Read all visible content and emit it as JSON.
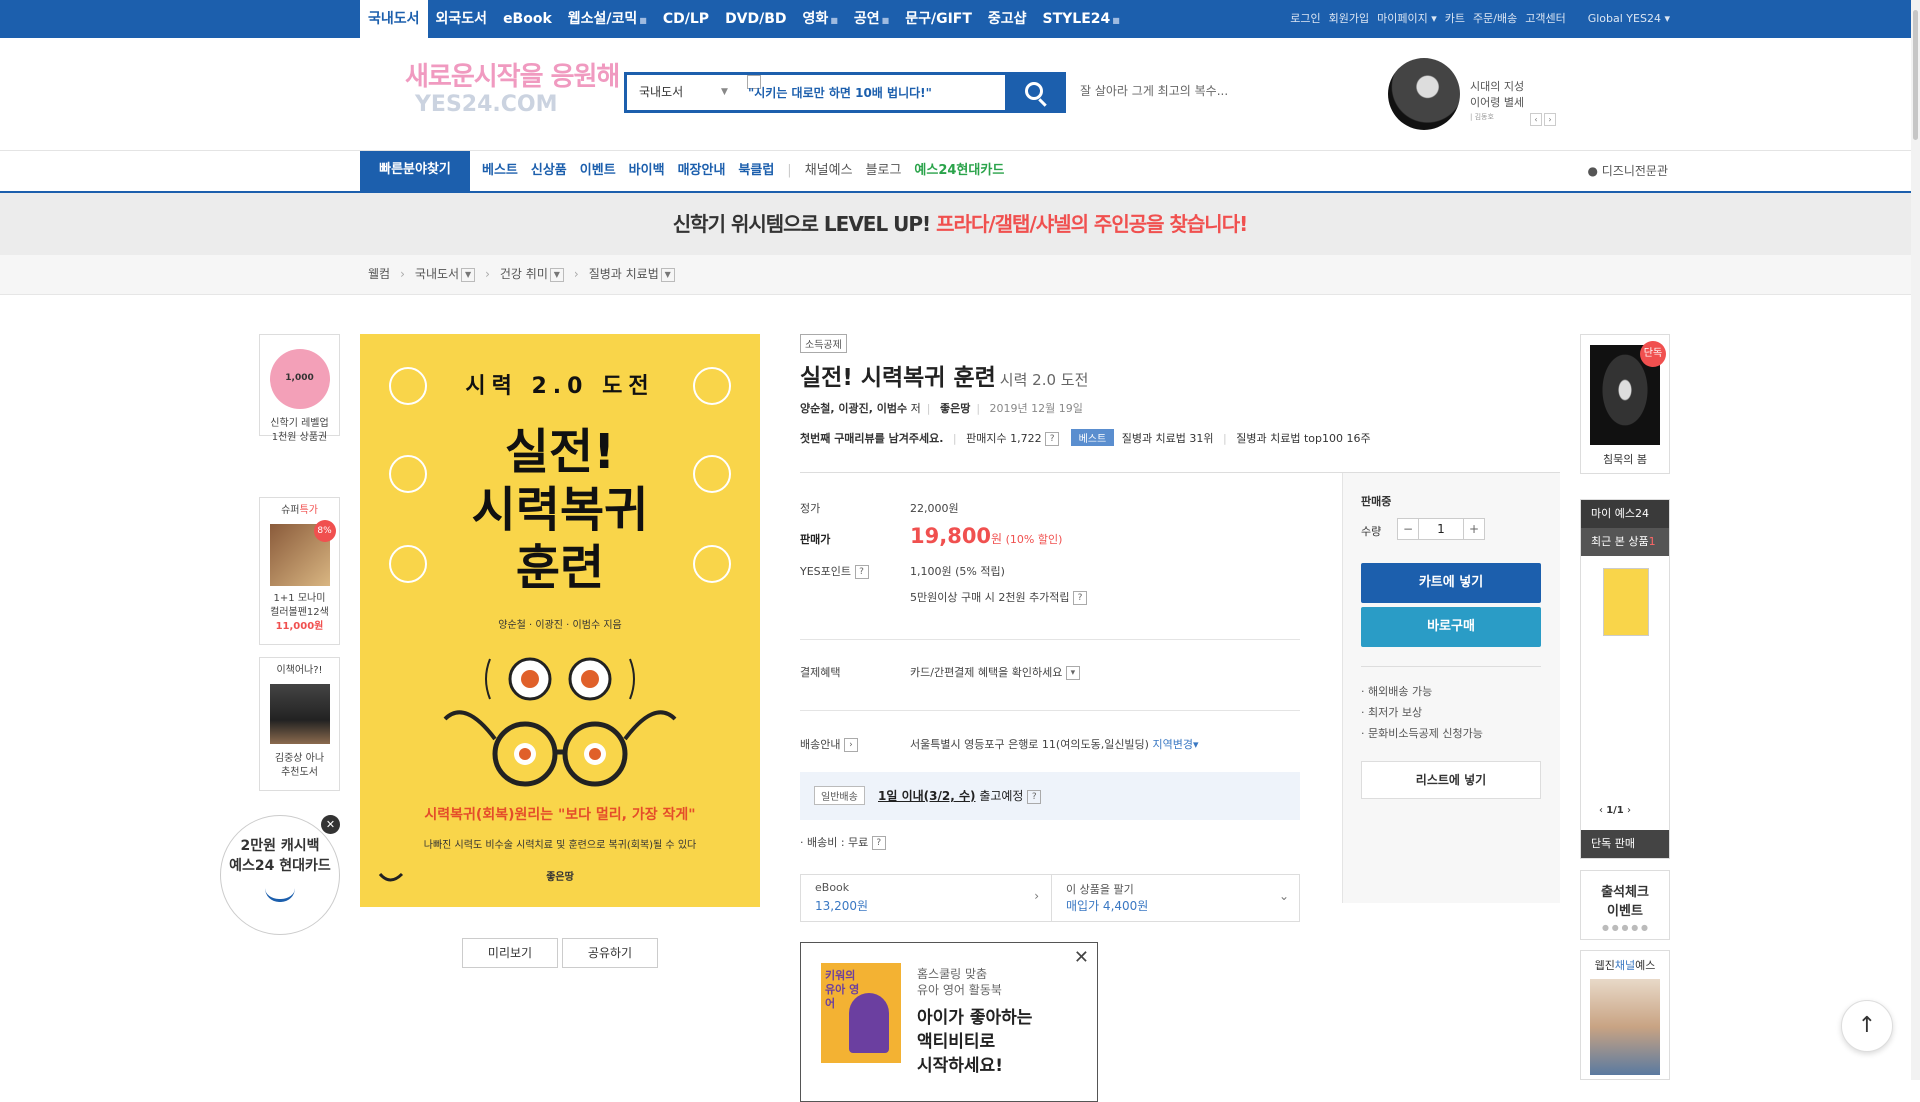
{
  "top_nav": {
    "items": [
      "국내도서",
      "외국도서",
      "eBook",
      "웹소설/코믹",
      "CD/LP",
      "DVD/BD",
      "영화",
      "공연",
      "문구/GIFT",
      "중고샵",
      "STYLE24"
    ],
    "active": "국내도서"
  },
  "top_util": [
    "로그인",
    "회원가입",
    "마이페이지",
    "카트",
    "주문/배송",
    "고객센터"
  ],
  "global_label": "Global YES24",
  "logo": {
    "line1": "새로운시작을 응원해",
    "line2": "YES24.COM"
  },
  "search": {
    "category": "국내도서",
    "query": "\"시키는 대로만 하면 10배 법니다!\"",
    "hint": "잘 살아라 그게 최고의 복수..."
  },
  "author_ad": {
    "line1": "시대의 지성",
    "line2": "이어령 별세",
    "line3": "| 김동호"
  },
  "gnb": {
    "quick": "빠른분야찾기",
    "items": [
      "베스트",
      "신상품",
      "이벤트",
      "바이백",
      "매장안내",
      "북클럽"
    ],
    "extra": [
      "채널예스",
      "블로그"
    ],
    "card": "예스24현대카드",
    "disney": "디즈니전문관"
  },
  "banner": {
    "text1": "신학기 위시템으로 LEVEL UP!",
    "text2": "프라다/갤탭/샤넬의 주인공을 찾습니다!"
  },
  "breadcrumb": [
    "웰컴",
    "국내도서",
    "건강 취미",
    "질병과 치료법"
  ],
  "left_side": {
    "box1": {
      "badge": "1,000",
      "line1": "신학기 레벨업",
      "line2": "1천원 상품권"
    },
    "box2": {
      "head_a": "슈퍼",
      "head_b": "특가",
      "badge": "8%",
      "line1": "1+1 모나미",
      "line2": "컬러볼펜12색",
      "price": "11,000원"
    },
    "box3": {
      "head": "이책어나?!",
      "line1": "김중상 아나",
      "line2": "추천도서"
    },
    "cashback": {
      "line1": "2만원 캐시백",
      "line2": "예스24 현대카드"
    }
  },
  "cover": {
    "top": "시력 2.0 도전",
    "title1": "실전!",
    "title2": "시력복귀",
    "title3": "훈련",
    "authors": "양순철 · 이광진 · 이범수 지음",
    "red_line": "시력복귀(회복)원리는 \"보다 멀리, 가장 작게\"",
    "desc": "나빠진 시력도 비수술 시력치료 및 훈련으로 복귀(회복)될 수 있다",
    "publisher": "좋은땅"
  },
  "buttons": {
    "preview": "미리보기",
    "share": "공유하기"
  },
  "product": {
    "tag": "소득공제",
    "title": "실전! 시력복귀 훈련",
    "subtitle": "시력 2.0 도전",
    "authors": "양순철, 이광진, 이범수",
    "author_suffix": "저",
    "publisher": "좋은땅",
    "date": "2019년 12월 19일",
    "review_cta": "첫번째 구매리뷰를 남겨주세요.",
    "sales_index": "판매지수 1,722",
    "best_badge": "베스트",
    "rank1": "질병과 치료법 31위",
    "rank2": "질병과 치료법 top100 16주"
  },
  "price": {
    "list_label": "정가",
    "list_value": "22,000원",
    "sale_label": "판매가",
    "sale_value": "19,800",
    "sale_unit": "원",
    "discount": "(10% 할인)",
    "point_label": "YES포인트",
    "point_value": "1,100원 (5% 적립)",
    "point_extra": "5만원이상 구매 시 2천원 추가적립",
    "pay_label": "결제혜택",
    "pay_value": "카드/간편결제 혜택을 확인하세요",
    "ship_label": "배송안내",
    "ship_addr": "서울특별시 영등포구 은행로 11(여의도동,일신빌딩)",
    "ship_change": "지역변경",
    "delivery_tag": "일반배송",
    "delivery_main": "1일 이내(3/2, 수)",
    "delivery_suffix": "출고예정",
    "fee": "· 배송비 : 무료"
  },
  "ebook_row": {
    "ebook_label": "eBook",
    "ebook_price": "13,200원",
    "sell_label": "이 상품을 팔기",
    "sell_price": "매입가 4,400원"
  },
  "ad": {
    "line1": "홈스쿨링 맞춤",
    "line2": "유아 영어 활동북",
    "line3": "아이가 좋아하는",
    "line4": "액티비티로",
    "line5": "시작하세요!",
    "book_text": "키워의 유아 영어"
  },
  "buy_box": {
    "status": "판매중",
    "qty_label": "수량",
    "qty_value": "1",
    "cart": "카트에 넣기",
    "buy": "바로구매",
    "notes": [
      "· 해외배송 가능",
      "· 최저가 보상",
      "· 문화비소득공제 신청가능"
    ],
    "list": "리스트에 넣기"
  },
  "right_side": {
    "exclusive_badge": "단독",
    "exclusive_title": "침묵의 봄",
    "my_yes": "마이 예스24",
    "recent": "최근 본 상품",
    "recent_count": "1",
    "page": "1/1",
    "exclusive_sale": "단독 판매",
    "attend1": "출석체크",
    "attend2": "이벤트",
    "channel_a": "웹진",
    "channel_b": "채널",
    "channel_c": "예스"
  }
}
